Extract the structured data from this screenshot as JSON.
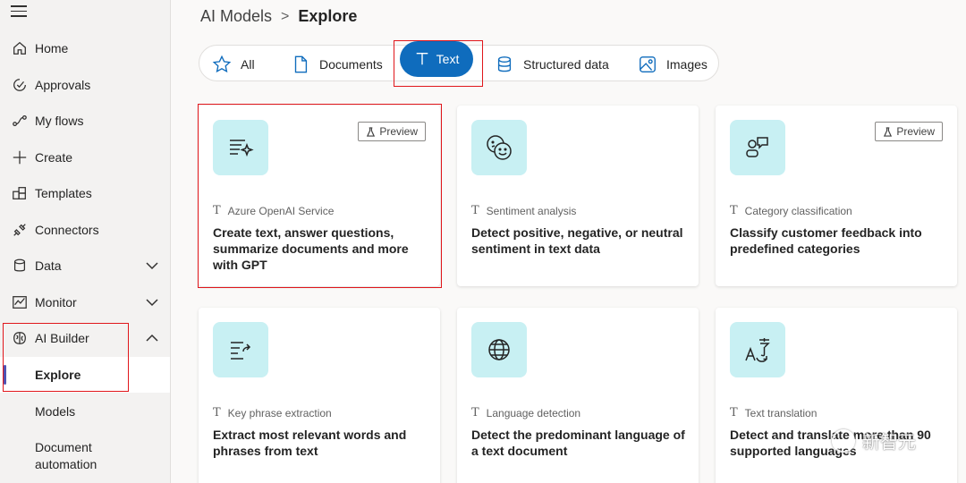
{
  "breadcrumb": {
    "parent": "AI Models",
    "separator": ">",
    "current": "Explore"
  },
  "sidebar": {
    "items": [
      {
        "label": "Home",
        "icon": "home-icon"
      },
      {
        "label": "Approvals",
        "icon": "approvals-icon"
      },
      {
        "label": "My flows",
        "icon": "flows-icon"
      },
      {
        "label": "Create",
        "icon": "plus-icon"
      },
      {
        "label": "Templates",
        "icon": "templates-icon"
      },
      {
        "label": "Connectors",
        "icon": "connector-icon"
      },
      {
        "label": "Data",
        "icon": "database-icon"
      },
      {
        "label": "Monitor",
        "icon": "monitor-icon"
      },
      {
        "label": "AI Builder",
        "icon": "brain-icon"
      }
    ],
    "sub_items": [
      {
        "label": "Explore"
      },
      {
        "label": "Models"
      },
      {
        "label": "Document automation"
      }
    ]
  },
  "filters": [
    {
      "label": "All",
      "icon": "star-icon"
    },
    {
      "label": "Documents",
      "icon": "document-icon"
    },
    {
      "label": "Text",
      "icon": "text-icon",
      "selected": true
    },
    {
      "label": "Structured data",
      "icon": "database-icon"
    },
    {
      "label": "Images",
      "icon": "image-icon"
    }
  ],
  "preview_label": "Preview",
  "cards": [
    {
      "category": "Azure OpenAI Service",
      "description": "Create text, answer questions, summarize documents and more with GPT",
      "preview": true,
      "icon": "sparkle-text-icon"
    },
    {
      "category": "Sentiment analysis",
      "description": "Detect positive, negative, or neutral sentiment in text data",
      "preview": false,
      "icon": "emoji-icon"
    },
    {
      "category": "Category classification",
      "description": "Classify customer feedback into predefined categories",
      "preview": true,
      "icon": "shapes-icon"
    },
    {
      "category": "Key phrase extraction",
      "description": "Extract most relevant words and phrases from text",
      "preview": false,
      "icon": "text-extract-icon"
    },
    {
      "category": "Language detection",
      "description": "Detect the predominant language of a text document",
      "preview": false,
      "icon": "globe-icon"
    },
    {
      "category": "Text translation",
      "description": "Detect and translate more than 90 supported languages",
      "preview": false,
      "icon": "translate-icon"
    }
  ],
  "watermark": {
    "text": "新智元"
  },
  "colors": {
    "accent": "#0f6cbd",
    "tile": "#c8f0f3",
    "highlight": "#e0161b",
    "active_bar": "#4f52b2"
  }
}
